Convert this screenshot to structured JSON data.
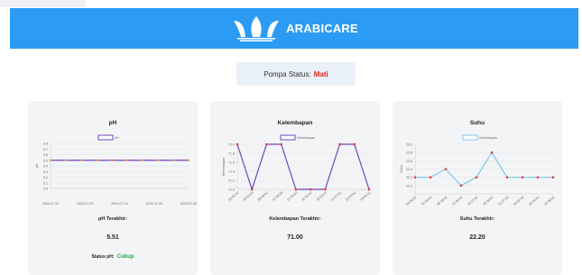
{
  "header": {
    "brand": "ARABICARE"
  },
  "pump": {
    "label": "Pompa Status:",
    "status": "Mati"
  },
  "colors": {
    "header": "#2b9bf3",
    "pump_off": "#e0241b",
    "status_ok": "#1aa64a",
    "ph_line": "#6b46c1",
    "kelembapan_line": "#6b46c1",
    "suhu_line": "#7dc8ec"
  },
  "cards": {
    "ph": {
      "title": "pH",
      "latest_label": "pH Terakhir:",
      "latest_value": "5.51",
      "status_label": "Status pH:",
      "status_value": "Cukup"
    },
    "kelembapan": {
      "title": "Kelembapan",
      "latest_label": "Kelembapan Terakhir:",
      "latest_value": "71.00"
    },
    "suhu": {
      "title": "Suhu",
      "latest_label": "Suhu Terakhir:",
      "latest_value": "22.20"
    }
  },
  "chart_data": [
    {
      "type": "line",
      "series": [
        {
          "name": "pH",
          "values": [
            5.5,
            5.5,
            5.5,
            5.5,
            5.5,
            5.5,
            5.5,
            5.5,
            5.5,
            5.5
          ]
        }
      ],
      "x_ticks": [
        "2024-07-22",
        "2024-07-23",
        "2024-07-24",
        "2024-07-25",
        "2024-07-26"
      ],
      "ylabel": "pH",
      "y_ticks": [
        "5.8",
        "5.7",
        "5.6",
        "5.5",
        "5.4",
        "5.3",
        "5.2",
        "5.1",
        "5.0"
      ],
      "ylim": [
        5.0,
        5.8
      ],
      "legend": "top"
    },
    {
      "type": "line",
      "series": [
        {
          "name": "Kelembapan",
          "values": [
            72.0,
            71.0,
            72.0,
            72.0,
            71.0,
            71.0,
            71.0,
            72.0,
            72.0,
            71.0
          ]
        }
      ],
      "categories": [
        "04:55:32",
        "05:01:03",
        "08:08:02",
        "12:48:09",
        "15:35:02",
        "16:09:02",
        "18:32:03",
        "21:27:01",
        "23:05:02",
        "04:04:11"
      ],
      "ylabel": "Kelembapan",
      "y_ticks": [
        "72.0",
        "71.8",
        "71.6",
        "71.4",
        "71.2",
        "71.0"
      ],
      "ylim": [
        71.0,
        72.0
      ],
      "legend": "top"
    },
    {
      "type": "line",
      "series": [
        {
          "name": "Kelembapan",
          "values": [
            22.2,
            22.2,
            22.4,
            22.0,
            22.2,
            22.8,
            22.2,
            22.2,
            22.2,
            22.2
          ]
        }
      ],
      "categories": [
        "04:56:02",
        "05:08:02",
        "08:28:02",
        "12:00:02",
        "16:17:02",
        "18:38:02",
        "21:27:02",
        "04:02:02",
        "05:03:02",
        "12:48:02"
      ],
      "ylabel": "Suhu",
      "y_ticks": [
        "23.0",
        "22.8",
        "22.6",
        "22.4",
        "22.2",
        "22.0"
      ],
      "ylim": [
        21.8,
        23.0
      ],
      "legend": "top"
    }
  ]
}
